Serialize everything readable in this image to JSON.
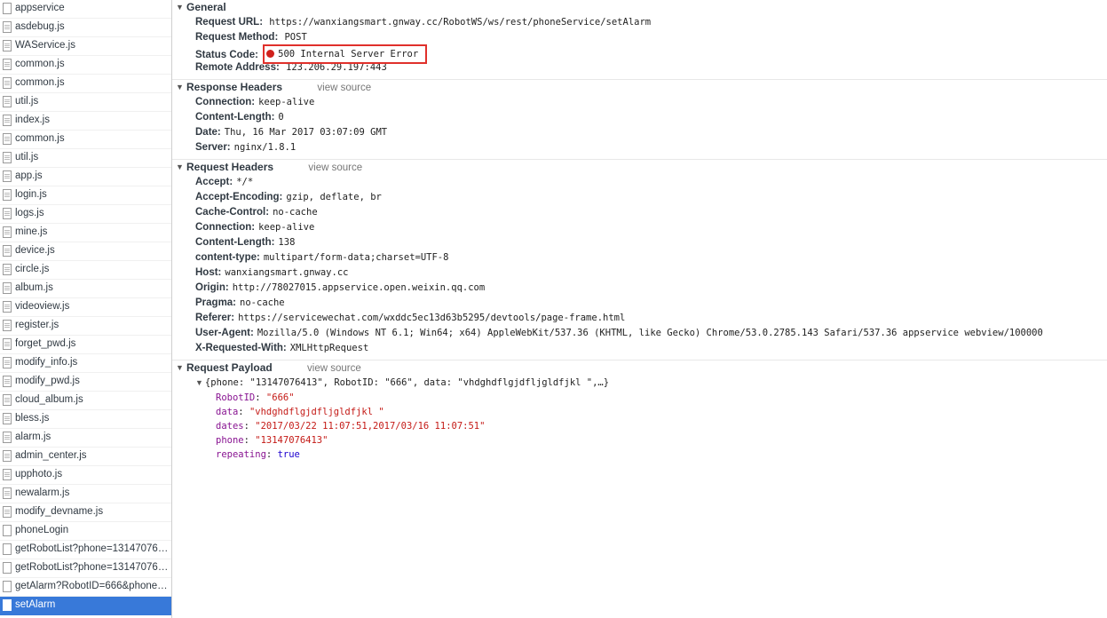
{
  "sidebar": {
    "files": [
      {
        "name": "appservice",
        "type": "doc"
      },
      {
        "name": "asdebug.js",
        "type": "script"
      },
      {
        "name": "WAService.js",
        "type": "script"
      },
      {
        "name": "common.js",
        "type": "script"
      },
      {
        "name": "common.js",
        "type": "script"
      },
      {
        "name": "util.js",
        "type": "script"
      },
      {
        "name": "index.js",
        "type": "script"
      },
      {
        "name": "common.js",
        "type": "script"
      },
      {
        "name": "util.js",
        "type": "script"
      },
      {
        "name": "app.js",
        "type": "script"
      },
      {
        "name": "login.js",
        "type": "script"
      },
      {
        "name": "logs.js",
        "type": "script"
      },
      {
        "name": "mine.js",
        "type": "script"
      },
      {
        "name": "device.js",
        "type": "script"
      },
      {
        "name": "circle.js",
        "type": "script"
      },
      {
        "name": "album.js",
        "type": "script"
      },
      {
        "name": "videoview.js",
        "type": "script"
      },
      {
        "name": "register.js",
        "type": "script"
      },
      {
        "name": "forget_pwd.js",
        "type": "script"
      },
      {
        "name": "modify_info.js",
        "type": "script"
      },
      {
        "name": "modify_pwd.js",
        "type": "script"
      },
      {
        "name": "cloud_album.js",
        "type": "script"
      },
      {
        "name": "bless.js",
        "type": "script"
      },
      {
        "name": "alarm.js",
        "type": "script"
      },
      {
        "name": "admin_center.js",
        "type": "script"
      },
      {
        "name": "upphoto.js",
        "type": "script"
      },
      {
        "name": "newalarm.js",
        "type": "script"
      },
      {
        "name": "modify_devname.js",
        "type": "script"
      },
      {
        "name": "phoneLogin",
        "type": "doc"
      },
      {
        "name": "getRobotList?phone=13147076413",
        "type": "doc"
      },
      {
        "name": "getRobotList?phone=13147076413",
        "type": "doc"
      },
      {
        "name": "getAlarm?RobotID=666&phone=...",
        "type": "doc"
      },
      {
        "name": "setAlarm",
        "type": "doc",
        "selected": true
      }
    ]
  },
  "general": {
    "title": "General",
    "request_url_label": "Request URL:",
    "request_url": "https://wanxiangsmart.gnway.cc/RobotWS/ws/rest/phoneService/setAlarm",
    "request_method_label": "Request Method:",
    "request_method": "POST",
    "status_code_label": "Status Code:",
    "status_code": "500 Internal Server Error",
    "status_color": "#d0211c",
    "remote_address_label": "Remote Address:",
    "remote_address": "123.206.29.197:443"
  },
  "response_headers": {
    "title": "Response Headers",
    "view_source": "view source",
    "items": [
      {
        "key": "Connection:",
        "value": "keep-alive"
      },
      {
        "key": "Content-Length:",
        "value": "0"
      },
      {
        "key": "Date:",
        "value": "Thu, 16 Mar 2017 03:07:09 GMT"
      },
      {
        "key": "Server:",
        "value": "nginx/1.8.1"
      }
    ]
  },
  "request_headers": {
    "title": "Request Headers",
    "view_source": "view source",
    "items": [
      {
        "key": "Accept:",
        "value": "*/*"
      },
      {
        "key": "Accept-Encoding:",
        "value": "gzip, deflate, br"
      },
      {
        "key": "Cache-Control:",
        "value": "no-cache"
      },
      {
        "key": "Connection:",
        "value": "keep-alive"
      },
      {
        "key": "Content-Length:",
        "value": "138"
      },
      {
        "key": "content-type:",
        "value": "multipart/form-data;charset=UTF-8"
      },
      {
        "key": "Host:",
        "value": "wanxiangsmart.gnway.cc"
      },
      {
        "key": "Origin:",
        "value": "http://78027015.appservice.open.weixin.qq.com"
      },
      {
        "key": "Pragma:",
        "value": "no-cache"
      },
      {
        "key": "Referer:",
        "value": "https://servicewechat.com/wxddc5ec13d63b5295/devtools/page-frame.html"
      },
      {
        "key": "User-Agent:",
        "value": "Mozilla/5.0 (Windows NT 6.1; Win64; x64) AppleWebKit/537.36 (KHTML, like Gecko) Chrome/53.0.2785.143 Safari/537.36 appservice webview/100000"
      },
      {
        "key": "X-Requested-With:",
        "value": "XMLHttpRequest"
      }
    ]
  },
  "request_payload": {
    "title": "Request Payload",
    "view_source": "view source",
    "summary": "{phone: \"13147076413\", RobotID: \"666\", data: \"vhdghdflgjdfljgldfjkl \",…}",
    "fields": [
      {
        "key": "RobotID",
        "value": "\"666\"",
        "kind": "string"
      },
      {
        "key": "data",
        "value": "\"vhdghdflgjdfljgldfjkl \"",
        "kind": "string"
      },
      {
        "key": "dates",
        "value": "\"2017/03/22 11:07:51,2017/03/16 11:07:51\"",
        "kind": "string"
      },
      {
        "key": "phone",
        "value": "\"13147076413\"",
        "kind": "string"
      },
      {
        "key": "repeating",
        "value": "true",
        "kind": "bool"
      }
    ]
  }
}
